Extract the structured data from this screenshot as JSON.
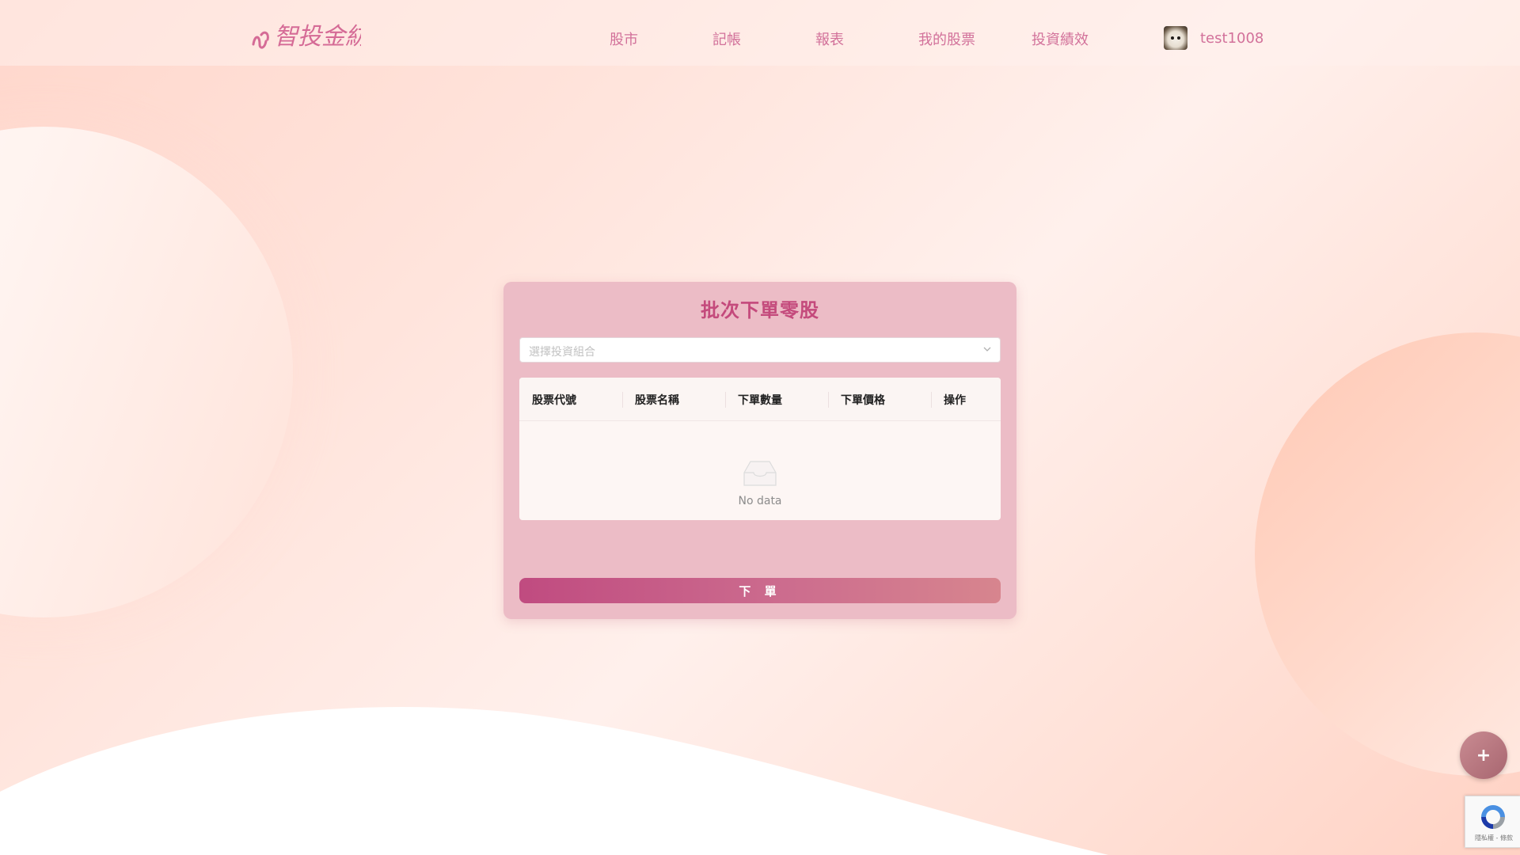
{
  "nav": {
    "logo_text": "智投金紡",
    "items": [
      {
        "label": "股市"
      },
      {
        "label": "記帳"
      },
      {
        "label": "報表"
      },
      {
        "label": "我的股票"
      },
      {
        "label": "投資績效"
      }
    ],
    "username": "test1008"
  },
  "card": {
    "title": "批次下單零股",
    "select_placeholder": "選擇投資組合",
    "table": {
      "columns": [
        "股票代號",
        "股票名稱",
        "下單數量",
        "下單價格",
        "操作"
      ],
      "rows": [],
      "empty_text": "No data"
    },
    "submit_label": "下 單"
  },
  "fab_label": "+",
  "recaptcha_text": "隱私權 - 條款",
  "colors": {
    "accent": "#c44a7c",
    "nav_text": "#d2719a",
    "card_bg": "#ecbcc6"
  }
}
